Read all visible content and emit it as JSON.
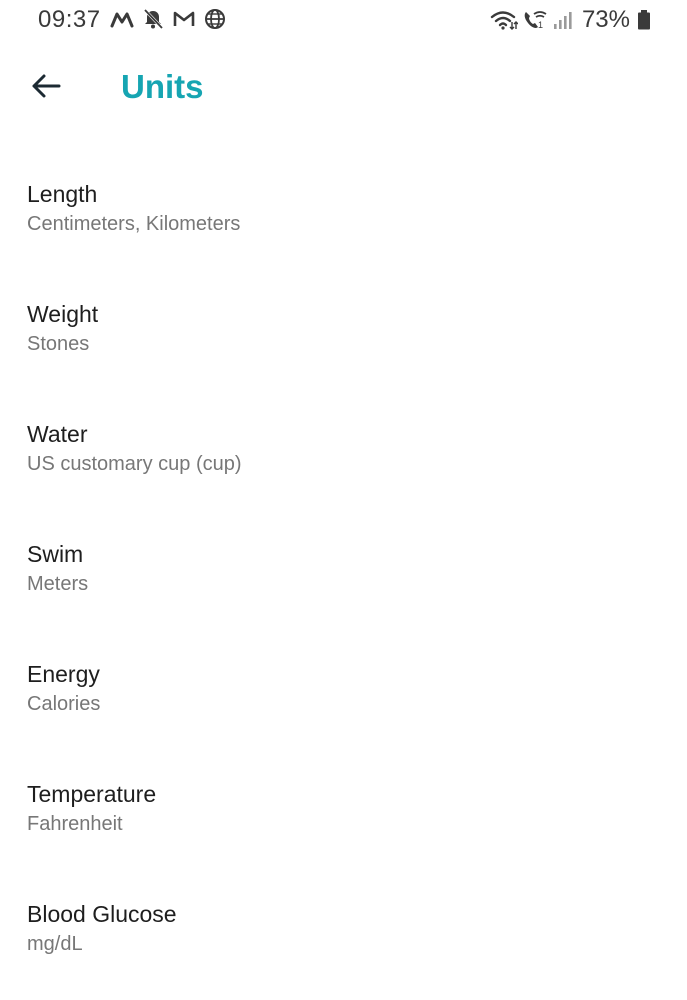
{
  "status_bar": {
    "time": "09:37",
    "battery": "73%",
    "left_icons": [
      "m-notification-icon",
      "mute-bell-icon",
      "gmail-icon",
      "globe-icon"
    ],
    "right_icons": [
      "wifi-icon",
      "wifi-calling-icon",
      "signal-icon",
      "battery-icon"
    ]
  },
  "app_bar": {
    "title": "Units",
    "back_icon": "arrow-left-icon",
    "accent_color": "#16a5b2"
  },
  "units": [
    {
      "label": "Length",
      "value": "Centimeters, Kilometers"
    },
    {
      "label": "Weight",
      "value": "Stones"
    },
    {
      "label": "Water",
      "value": "US customary cup (cup)"
    },
    {
      "label": "Swim",
      "value": "Meters"
    },
    {
      "label": "Energy",
      "value": "Calories"
    },
    {
      "label": "Temperature",
      "value": "Fahrenheit"
    },
    {
      "label": "Blood Glucose",
      "value": "mg/dL"
    }
  ]
}
